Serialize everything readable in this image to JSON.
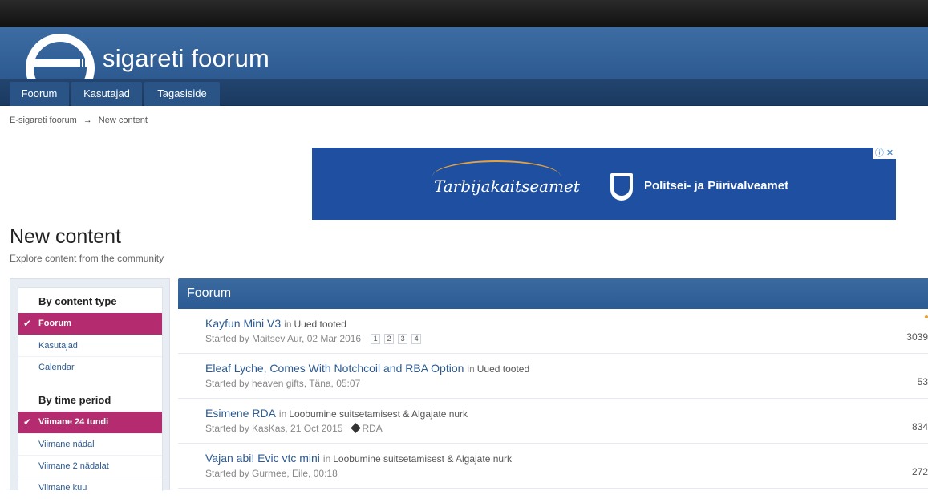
{
  "site": {
    "title": "sigareti foorum"
  },
  "nav": {
    "tabs": [
      {
        "label": "Foorum"
      },
      {
        "label": "Kasutajad"
      },
      {
        "label": "Tagasiside"
      }
    ]
  },
  "breadcrumb": {
    "items": [
      "E-sigareti foorum",
      "New content"
    ],
    "separator": "→"
  },
  "ad": {
    "brand1": "Tarbijakaitseamet",
    "brand2": "Politsei- ja Piirivalveamet",
    "info_icon": "ⓘ",
    "close_icon": "✕"
  },
  "page": {
    "title": "New content",
    "subtitle": "Explore content from the community"
  },
  "sidebar": {
    "content_type": {
      "heading": "By content type",
      "items": [
        "Foorum",
        "Kasutajad",
        "Calendar"
      ],
      "active": "Foorum"
    },
    "time_period": {
      "heading": "By time period",
      "items": [
        "Viimane 24 tundi",
        "Viimane nädal",
        "Viimane 2 nädalat",
        "Viimane kuu"
      ],
      "active": "Viimane 24 tundi"
    }
  },
  "panel": {
    "title": "Foorum",
    "in_word": "in",
    "rows": [
      {
        "title": "Kayfun Mini V3",
        "forum": "Uued tooted",
        "meta": "Started by Maitsev Aur, 02 Mar 2016",
        "pages": [
          "1",
          "2",
          "3",
          "4"
        ],
        "tag": "",
        "stat": "3039"
      },
      {
        "title": "Eleaf Lyche, Comes With Notchcoil and RBA Option",
        "forum": "Uued tooted",
        "meta": "Started by heaven gifts, Täna, 05:07",
        "pages": [],
        "tag": "",
        "stat": "53"
      },
      {
        "title": "Esimene RDA",
        "forum": "Loobumine suitsetamisest & Algajate nurk",
        "meta": "Started by KasKas, 21 Oct 2015",
        "pages": [],
        "tag": "RDA",
        "stat": "834"
      },
      {
        "title": "Vajan abi! Evic vtc mini",
        "forum": "Loobumine suitsetamisest & Algajate nurk",
        "meta": "Started by Gurmee, Eile, 00:18",
        "pages": [],
        "tag": "",
        "stat": "272"
      }
    ]
  },
  "colors": {
    "header": "#2c5a91",
    "nav": "#1b3a62",
    "active": "#b42c6f",
    "link": "#2c5a91"
  }
}
